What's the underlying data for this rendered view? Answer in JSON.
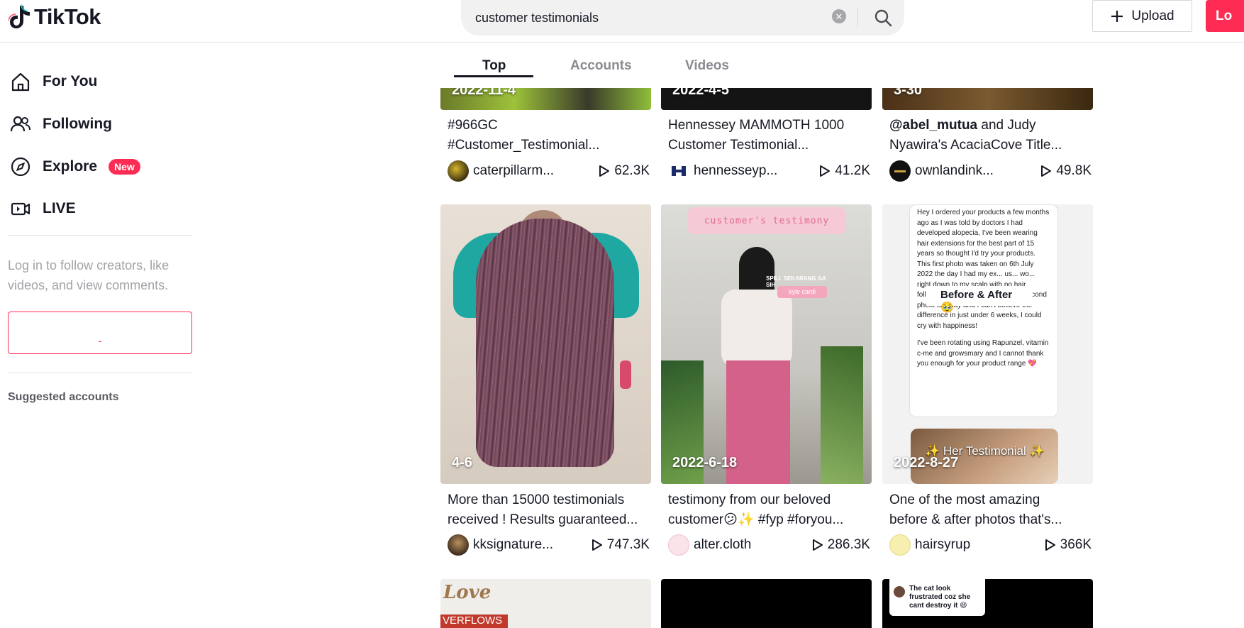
{
  "header": {
    "logo_text": "TikTok",
    "search_value": "customer testimonials",
    "upload_label": "Upload",
    "login_label": "Lo"
  },
  "sidebar": {
    "nav": [
      {
        "label": "For You",
        "icon": "home-icon"
      },
      {
        "label": "Following",
        "icon": "following-icon"
      },
      {
        "label": "Explore",
        "icon": "compass-icon",
        "badge": "New"
      },
      {
        "label": "LIVE",
        "icon": "live-icon"
      }
    ],
    "login_hint": "Log in to follow creators, like videos, and view comments.",
    "login_box_label": "-",
    "suggested": "Suggested accounts"
  },
  "tabs": [
    "Top",
    "Accounts",
    "Videos"
  ],
  "colors": {
    "accent": "#fe2c55",
    "text": "#161823"
  },
  "videos": [
    {
      "date": "2022-11-4",
      "caption_line1": "#966GC",
      "caption_line2": "#Customer_Testimonial...",
      "author": "caterpillarm...",
      "plays": "62.3K"
    },
    {
      "date": "2022-4-5",
      "caption_line1": "Hennessey MAMMOTH 1000",
      "caption_line2": "Customer Testimonial...",
      "author": "hennesseyp...",
      "plays": "41.2K"
    },
    {
      "date": "3-30",
      "caption_bold": "@abel_mutua",
      "caption_line1": " and Judy",
      "caption_line2": "Nyawira's AcaciaCove Title...",
      "author": "ownlandink...",
      "plays": "49.8K"
    },
    {
      "date": "4-6",
      "caption_line1": "More than 15000 testimonials",
      "caption_line2": "received ! Results guaranteed...",
      "author": "kksignature...",
      "plays": "747.3K"
    },
    {
      "date": "2022-6-18",
      "caption_line1": "testimony from our beloved",
      "caption_line2": "customer😕✨ #fyp #foryou...",
      "author": "alter.cloth",
      "plays": "286.3K",
      "overlay_title": "customer's testimony",
      "overlay_tag1": "SPILL SEKARANG GA SIH",
      "overlay_tag2": "kyle cardi"
    },
    {
      "date": "2022-8-27",
      "caption_line1": "One of the most amazing",
      "caption_line2": "before & after photos that's...",
      "author": "hairsyrup",
      "plays": "366K",
      "overlay_text": "Hey I ordered your products a few months ago as I was told by doctors I had developed alopecia, I've been wearing hair extensions for the best part of 15 years so thought I'd try your products. This first photo was taken on 6th July 2022 the day I had my ex... us... wo... right down to my scalp with no hair follicles coming through at all, the second photo is today and I can't believe the difference in just under 6 weeks, I could cry with happiness!",
      "overlay_text2": "I've been rotating using Rapunzel, vitamin c-me and growsmary and I cannot thank you enough for your product range 💖",
      "overlay_heading": "Before & After 🥹",
      "overlay_sub": "✨ Her Testimonial ✨"
    },
    {
      "overlay_text": "Love",
      "overlay_sub": "VERFLOWS"
    },
    {},
    {
      "overlay_text": "The cat look frustrated coz she cant destroy it 😆"
    }
  ]
}
